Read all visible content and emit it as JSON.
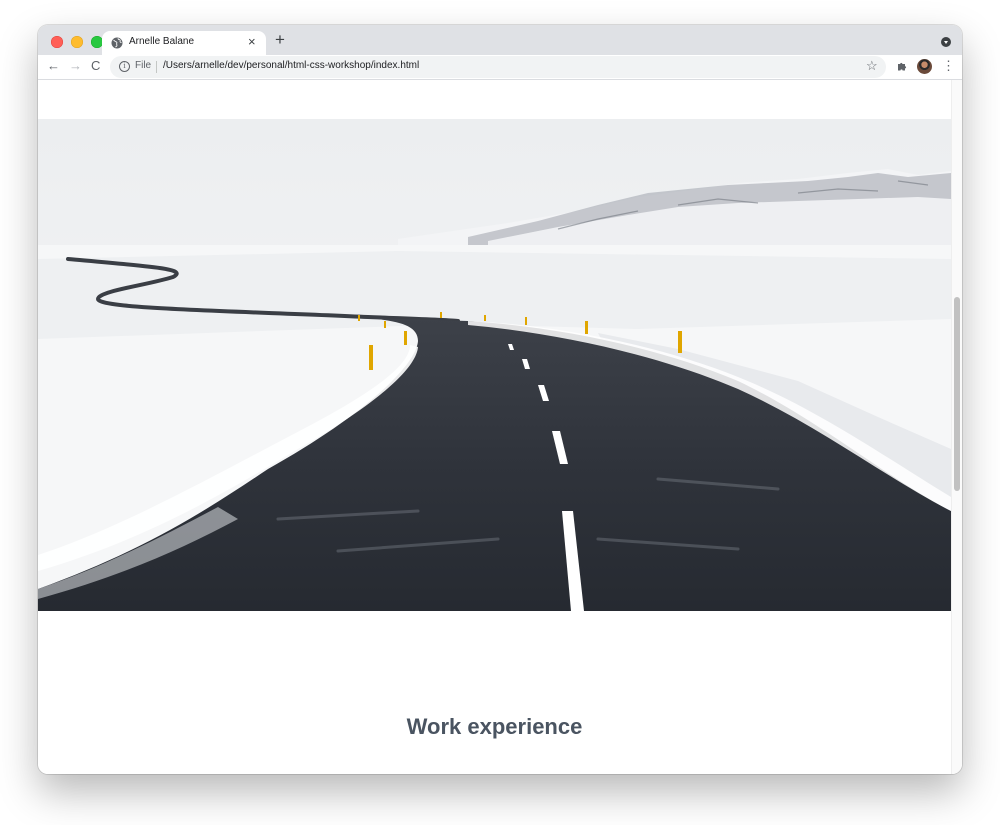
{
  "browser": {
    "tab_title": "Arnelle Balane",
    "tab_close_glyph": "×",
    "new_tab_glyph": "+",
    "back_glyph": "←",
    "forward_glyph": "→",
    "reload_glyph": "C",
    "info_glyph": "i",
    "scheme_label": "File",
    "url": "/Users/arnelle/dev/personal/html-css-workshop/index.html",
    "bookmark_glyph": "☆",
    "menu_glyph": "⋮",
    "icons": {
      "favicon": "globe-icon",
      "extensions": "puzzle-icon",
      "profile": "avatar-icon"
    }
  },
  "page": {
    "hero_image": "winding road through snowy landscape",
    "section_heading": "Work experience"
  },
  "colors": {
    "tabstrip_bg": "#dfe1e5",
    "heading": "#4a5461",
    "road": "#2b2f36",
    "road_line": "#ffffff",
    "pole": "#e0a600"
  }
}
